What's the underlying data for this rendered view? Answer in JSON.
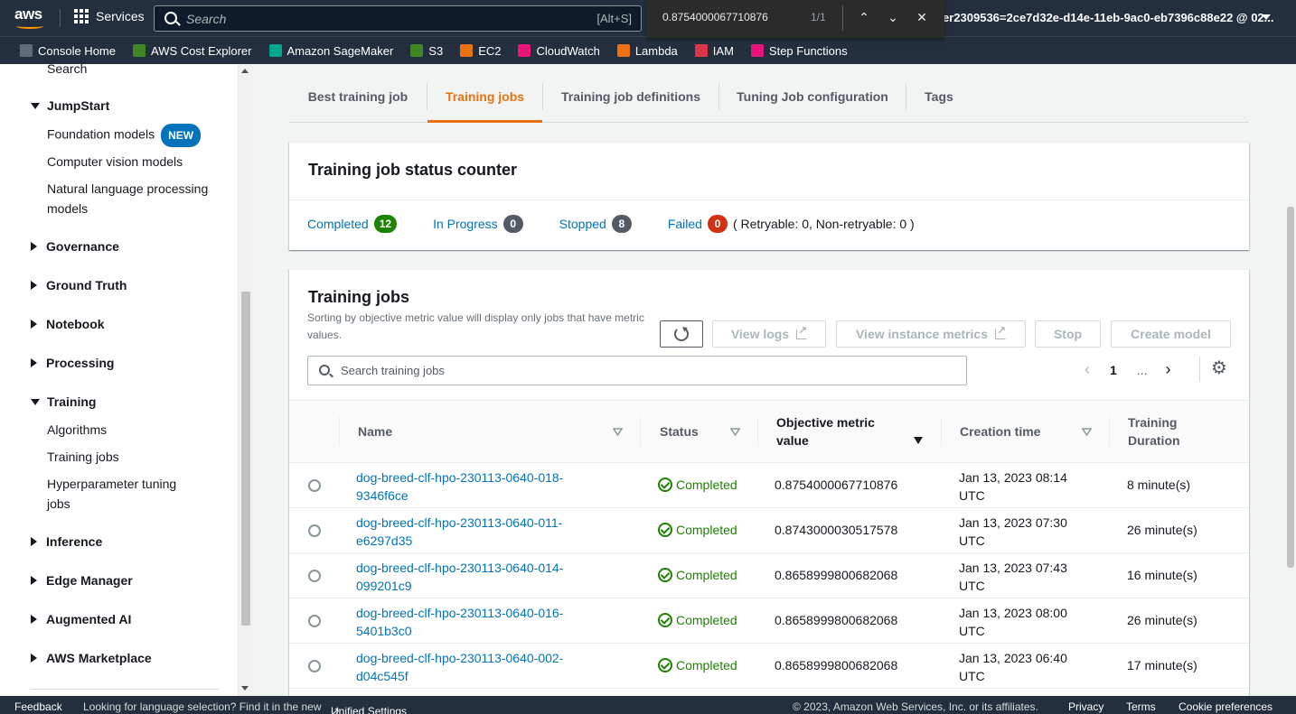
{
  "topnav": {
    "logo_text": "aws",
    "services_label": "Services",
    "search_placeholder": "Search",
    "search_shortcut": "[Alt+S]",
    "account_text": "er2309536=2ce7d32e-d14e-11eb-9ac0-eb7396c88e22 @ 02..."
  },
  "findbar": {
    "query": "0.8754000067710876",
    "count": "1/1",
    "up": "⌃",
    "down": "⌄",
    "close": "✕"
  },
  "favorites": [
    {
      "label": "Console Home",
      "color": "#5f6b7a"
    },
    {
      "label": "AWS Cost Explorer",
      "color": "#3f8624"
    },
    {
      "label": "Amazon SageMaker",
      "color": "#01a88d"
    },
    {
      "label": "S3",
      "color": "#3f8624"
    },
    {
      "label": "EC2",
      "color": "#ec7211"
    },
    {
      "label": "CloudWatch",
      "color": "#e7157b"
    },
    {
      "label": "Lambda",
      "color": "#ec7211"
    },
    {
      "label": "IAM",
      "color": "#dd344c"
    },
    {
      "label": "Step Functions",
      "color": "#e7157b"
    }
  ],
  "sidebar": {
    "search": "Search",
    "jumpstart": "JumpStart",
    "foundation_models": "Foundation models",
    "new_badge": "NEW",
    "computer_vision": "Computer vision models",
    "nlp": "Natural language processing models",
    "governance": "Governance",
    "ground_truth": "Ground Truth",
    "notebook": "Notebook",
    "processing": "Processing",
    "training": "Training",
    "algorithms": "Algorithms",
    "training_jobs": "Training jobs",
    "hpo_jobs": "Hyperparameter tuning jobs",
    "inference": "Inference",
    "edge_manager": "Edge Manager",
    "augmented_ai": "Augmented AI",
    "marketplace": "AWS Marketplace"
  },
  "tabs": [
    {
      "label": "Best training job"
    },
    {
      "label": "Training jobs"
    },
    {
      "label": "Training job definitions"
    },
    {
      "label": "Tuning Job configuration"
    },
    {
      "label": "Tags"
    }
  ],
  "status_counter": {
    "title": "Training job status counter",
    "completed_label": "Completed",
    "completed_count": "12",
    "in_progress_label": "In Progress",
    "in_progress_count": "0",
    "stopped_label": "Stopped",
    "stopped_count": "8",
    "failed_label": "Failed",
    "failed_count": "0",
    "retry_text": "( Retryable: 0, Non-retryable: 0 )",
    "colors": {
      "completed": "#1d8102",
      "in_progress": "#545b64",
      "stopped": "#545b64",
      "failed": "#d13212"
    }
  },
  "training_jobs": {
    "title": "Training jobs",
    "subtitle": "Sorting by objective metric value will display only jobs that have metric values.",
    "view_logs": "View logs",
    "view_instance_metrics": "View instance metrics",
    "stop": "Stop",
    "create_model": "Create model",
    "search_placeholder": "Search training jobs",
    "page": "1",
    "ellipsis": "...",
    "columns": {
      "name": "Name",
      "status": "Status",
      "metric": "Objective metric value",
      "creation_time": "Creation time",
      "duration": "Training Duration"
    },
    "rows": [
      {
        "name": "dog-breed-clf-hpo-230113-0640-018-9346f6ce",
        "status": "Completed",
        "metric": "0.8754000067710876",
        "time": "Jan 13, 2023 08:14 UTC",
        "duration": "8 minute(s)"
      },
      {
        "name": "dog-breed-clf-hpo-230113-0640-011-e6297d35",
        "status": "Completed",
        "metric": "0.8743000030517578",
        "time": "Jan 13, 2023 07:30 UTC",
        "duration": "26 minute(s)"
      },
      {
        "name": "dog-breed-clf-hpo-230113-0640-014-099201c9",
        "status": "Completed",
        "metric": "0.8658999800682068",
        "time": "Jan 13, 2023 07:43 UTC",
        "duration": "16 minute(s)"
      },
      {
        "name": "dog-breed-clf-hpo-230113-0640-016-5401b3c0",
        "status": "Completed",
        "metric": "0.8658999800682068",
        "time": "Jan 13, 2023 08:00 UTC",
        "duration": "26 minute(s)"
      },
      {
        "name": "dog-breed-clf-hpo-230113-0640-002-d04c545f",
        "status": "Completed",
        "metric": "0.8658999800682068",
        "time": "Jan 13, 2023 06:40 UTC",
        "duration": "17 minute(s)"
      }
    ]
  },
  "footer": {
    "feedback": "Feedback",
    "language_text": "Looking for language selection? Find it in the new",
    "unified_settings": "Unified Settings",
    "copyright": "© 2023, Amazon Web Services, Inc. or its affiliates.",
    "privacy": "Privacy",
    "terms": "Terms",
    "cookie": "Cookie preferences"
  }
}
